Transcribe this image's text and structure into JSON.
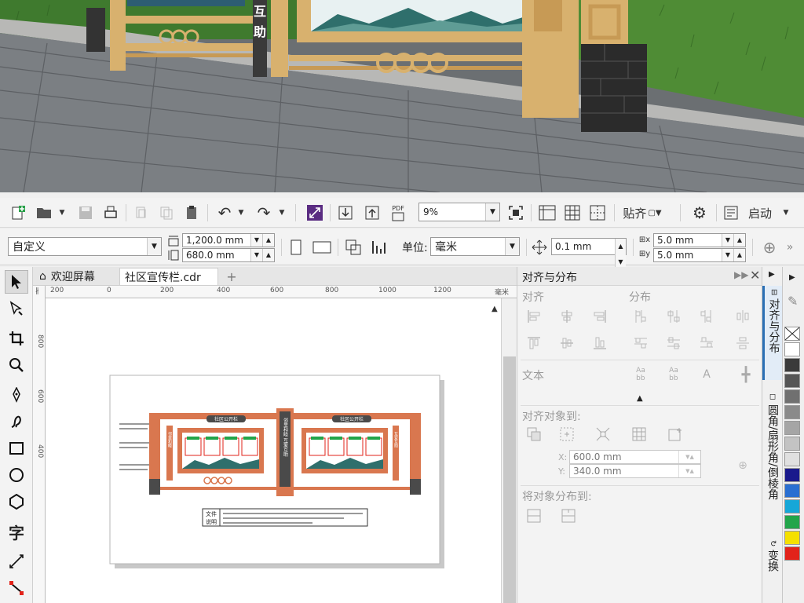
{
  "toolbar": {
    "zoom_value": "9%",
    "snap_label": "贴齐",
    "launch_label": "启动",
    "pdf_label": "PDF"
  },
  "propertybar": {
    "page_preset": "自定义",
    "width": "1,200.0 mm",
    "height": "680.0 mm",
    "units_label": "单位:",
    "units_value": "毫米",
    "nudge": "0.1 mm",
    "dup_x": "5.0 mm",
    "dup_y": "5.0 mm"
  },
  "tabs": {
    "welcome": "欢迎屏幕",
    "document": "社区宣传栏.cdr",
    "add": "+"
  },
  "ruler": {
    "h_ticks": [
      "200",
      "0",
      "200",
      "400",
      "600",
      "800",
      "1000",
      "1200"
    ],
    "unit": "毫米",
    "v_ticks": [
      "800",
      "600",
      "400"
    ]
  },
  "design": {
    "board_left_title": "社区公开栏",
    "board_right_title": "社区公开栏",
    "pillar_text": "邻里和睦 互爱互助",
    "photo_pillar_text": "互助",
    "side_text_left": "邻里和睦",
    "side_text_right": "互爱互助",
    "note_label_1": "文件",
    "note_label_2": "说明"
  },
  "docker": {
    "title": "对齐与分布",
    "align_label": "对齐",
    "distribute_label": "分布",
    "text_label": "文本",
    "align_to_label": "对齐对象到:",
    "x_value": "600.0 mm",
    "y_value": "340.0 mm",
    "x_axis": "X:",
    "y_axis": "Y:",
    "distribute_to_label": "将对象分布到:"
  },
  "vtabs": {
    "align": "对齐与分布",
    "corner": "圆角/扇形角/倒棱角",
    "transform": "变换"
  },
  "palette": {
    "colors": [
      "#ffffff",
      "#3a3a3a",
      "#555555",
      "#707070",
      "#8a8a8a",
      "#a5a5a5",
      "#c3c3c3",
      "#e0e0e0",
      "#1a1a8c",
      "#2a6fd1",
      "#16a7d8",
      "#22a54a",
      "#f5e000",
      "#e2231a"
    ]
  },
  "colors": {
    "frame_orange": "#d9774f",
    "pillar_dark": "#4a4a4a",
    "wood": "#d8b16e",
    "teal": "#2f6f6c"
  }
}
